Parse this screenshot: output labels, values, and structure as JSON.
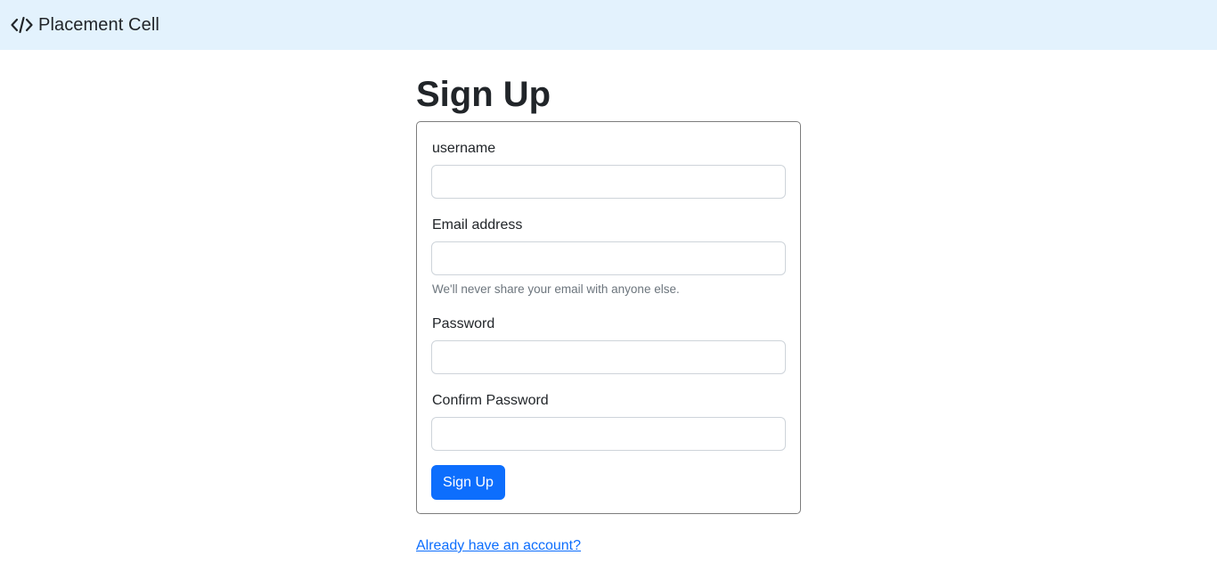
{
  "navbar": {
    "brand_label": "Placement Cell",
    "brand_icon": "code-slash-icon",
    "background": "#e3f2fd"
  },
  "page": {
    "title": "Sign Up"
  },
  "form": {
    "username": {
      "label": "username",
      "value": "",
      "placeholder": ""
    },
    "email": {
      "label": "Email address",
      "value": "",
      "placeholder": "",
      "help": "We'll never share your email with anyone else."
    },
    "password": {
      "label": "Password",
      "value": "",
      "placeholder": ""
    },
    "confirm_password": {
      "label": "Confirm Password",
      "value": "",
      "placeholder": ""
    },
    "submit_label": "Sign Up",
    "accent": "#0d6efd"
  },
  "footer": {
    "login_link": "Already have an account?"
  }
}
